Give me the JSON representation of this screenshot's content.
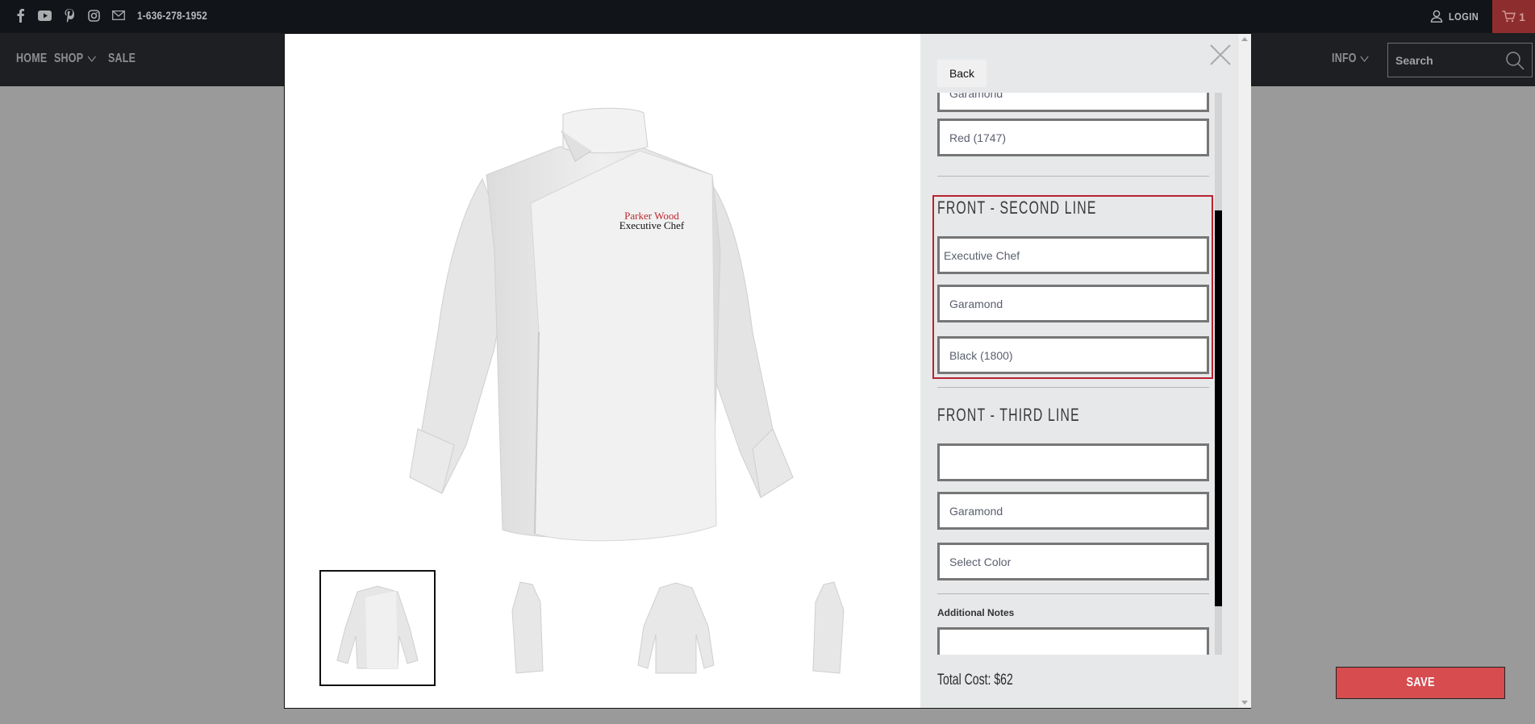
{
  "topbar": {
    "social_icons": [
      "facebook-icon",
      "youtube-icon",
      "pinterest-icon",
      "instagram-icon",
      "email-icon"
    ],
    "phone": "1-636-278-1952",
    "login_label": "LOGIN",
    "cart_count": "1"
  },
  "nav": {
    "items": [
      {
        "label": "HOME",
        "has_dropdown": false
      },
      {
        "label": "SHOP",
        "has_dropdown": true
      },
      {
        "label": "SALE",
        "has_dropdown": false
      }
    ],
    "info_label": "INFO",
    "search_placeholder": "Search"
  },
  "modal": {
    "product_embroidery": {
      "line1": "Parker Wood",
      "line1_color": "#c0262e",
      "line2": "Executive Chef",
      "line2_color": "#111111"
    },
    "thumbnails": [
      {
        "view": "front",
        "selected": true
      },
      {
        "view": "side-left",
        "selected": false
      },
      {
        "view": "back",
        "selected": false
      },
      {
        "view": "side-right",
        "selected": false
      }
    ],
    "panel": {
      "back_label": "Back",
      "first_line_partial": {
        "font": "Garamond",
        "color": "Red (1747)"
      },
      "sections": [
        {
          "title": "FRONT - SECOND LINE",
          "text_value": "Executive Chef",
          "font": "Garamond",
          "color": "Black (1800)",
          "highlighted": true
        },
        {
          "title": "FRONT - THIRD LINE",
          "text_value": "",
          "font": "Garamond",
          "color": "Select Color",
          "highlighted": false
        }
      ],
      "notes_label": "Additional Notes",
      "notes_value": "",
      "total_label": "Total Cost: $62",
      "save_label": "SAVE"
    }
  },
  "colors": {
    "accent_red": "#d64c4f",
    "highlight_border": "#b8232f",
    "cart_bg": "#8e2d2d",
    "topbar_bg": "#111418",
    "nav_bg": "#1d1f22"
  }
}
